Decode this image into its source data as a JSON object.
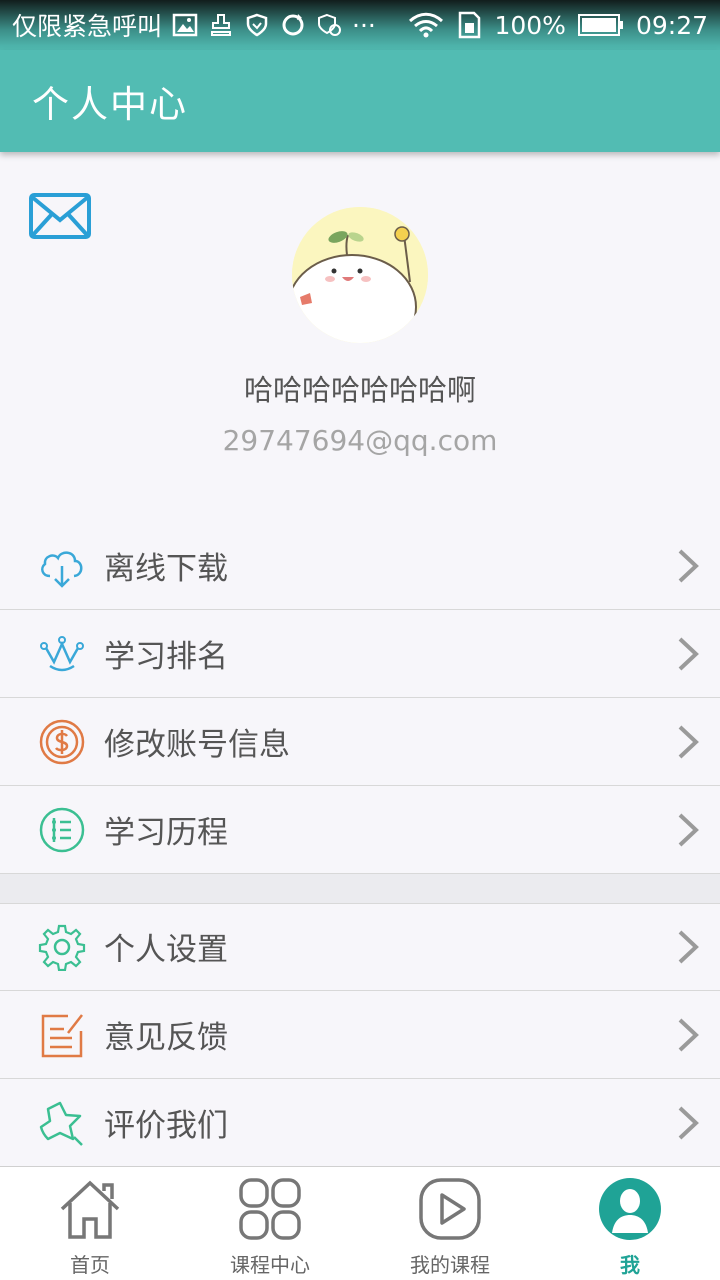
{
  "status_bar": {
    "notification_text": "仅限紧急呼叫",
    "overflow": "···",
    "battery": "100%",
    "time": "09:27"
  },
  "app_bar": {
    "title": "个人中心"
  },
  "profile": {
    "nickname": "哈哈哈哈哈哈哈啊",
    "email": "29747694@qq.com"
  },
  "menu_group_1": [
    {
      "label": "离线下载",
      "icon": "cloud-download-icon"
    },
    {
      "label": "学习排名",
      "icon": "crown-icon"
    },
    {
      "label": "修改账号信息",
      "icon": "dollar-coin-icon"
    },
    {
      "label": "学习历程",
      "icon": "list-icon"
    }
  ],
  "menu_group_2": [
    {
      "label": "个人设置",
      "icon": "gear-icon"
    },
    {
      "label": "意见反馈",
      "icon": "edit-note-icon"
    },
    {
      "label": "评价我们",
      "icon": "star-icon"
    }
  ],
  "tabs": [
    {
      "label": "首页",
      "icon": "home-icon"
    },
    {
      "label": "课程中心",
      "icon": "grid-icon"
    },
    {
      "label": "我的课程",
      "icon": "play-icon"
    },
    {
      "label": "我",
      "icon": "user-icon",
      "active": true
    }
  ],
  "colors": {
    "primary": "#52bcb3",
    "active_tab": "#1fa396",
    "mail_icon": "#2a9fd6"
  }
}
